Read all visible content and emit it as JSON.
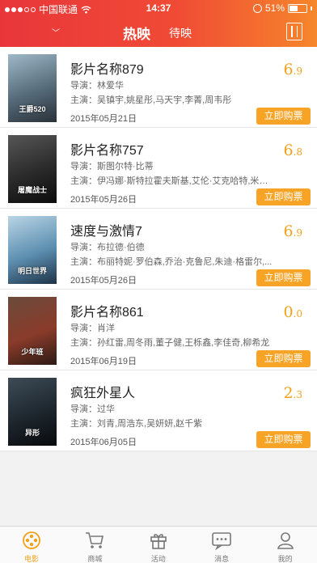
{
  "status_bar": {
    "carrier": "中国联通",
    "time": "14:37",
    "battery": "51%",
    "battery_level": 0.51
  },
  "header": {
    "tab_active": "热映",
    "tab_other": "待映"
  },
  "movies": [
    {
      "title": "影片名称879",
      "rating_int": "6",
      "rating_dec": ".9",
      "director": "导演：林爱华",
      "cast": "主演：吴镇宇,姚星彤,马天宇,李菁,周韦彤",
      "date": "2015年05月21日",
      "buy_label": "立即购票",
      "poster_text": "王爵520",
      "poster_colors": [
        "#9fb8c7",
        "#556b7a",
        "#2a3138"
      ]
    },
    {
      "title": "影片名称757",
      "rating_int": "6",
      "rating_dec": ".8",
      "director": "导演：斯图尔特·比蒂",
      "cast": "主演：伊冯娜·斯特拉霍夫斯基,艾伦·艾克哈特,米兰...",
      "date": "2015年05月26日",
      "buy_label": "立即购票",
      "poster_text": "屠魔战士",
      "poster_colors": [
        "#565656",
        "#2a2a2a",
        "#0c0c0c"
      ]
    },
    {
      "title": "速度与激情7",
      "rating_int": "6",
      "rating_dec": ".9",
      "director": "导演：布拉德·伯德",
      "cast": "主演：布丽特妮·罗伯森,乔治·克鲁尼,朱迪·格雷尔,...",
      "date": "2015年05月26日",
      "buy_label": "立即购票",
      "poster_text": "明日世界",
      "poster_colors": [
        "#b9d5e6",
        "#5d8fb0",
        "#1d3247"
      ]
    },
    {
      "title": "影片名称861",
      "rating_int": "0",
      "rating_dec": ".0",
      "director": "导演：肖洋",
      "cast": "主演：孙红雷,周冬雨,董子健,王栎鑫,李佳奇,柳希龙",
      "date": "2015年06月19日",
      "buy_label": "立即购票",
      "poster_text": "少年班",
      "poster_colors": [
        "#6b4b3c",
        "#8a3b2a",
        "#2b1a14"
      ]
    },
    {
      "title": "疯狂外星人",
      "rating_int": "2",
      "rating_dec": ".3",
      "director": "导演：过华",
      "cast": "主演：刘青,周浩东,吴妍妍,赵千紫",
      "date": "2015年06月05日",
      "buy_label": "立即购票",
      "poster_text": "异形",
      "poster_colors": [
        "#3d4c57",
        "#1d262d",
        "#080a0c"
      ]
    }
  ],
  "tabbar": [
    {
      "label": "电影",
      "icon": "film-reel-icon",
      "active": true
    },
    {
      "label": "商城",
      "icon": "cart-icon",
      "active": false
    },
    {
      "label": "活动",
      "icon": "gift-icon",
      "active": false
    },
    {
      "label": "消息",
      "icon": "message-icon",
      "active": false
    },
    {
      "label": "我的",
      "icon": "person-icon",
      "active": false
    }
  ],
  "colors": {
    "accent": "#f2a118",
    "buy_button": "#f7a325",
    "header_start": "#e9363a",
    "header_end": "#f6862b"
  }
}
